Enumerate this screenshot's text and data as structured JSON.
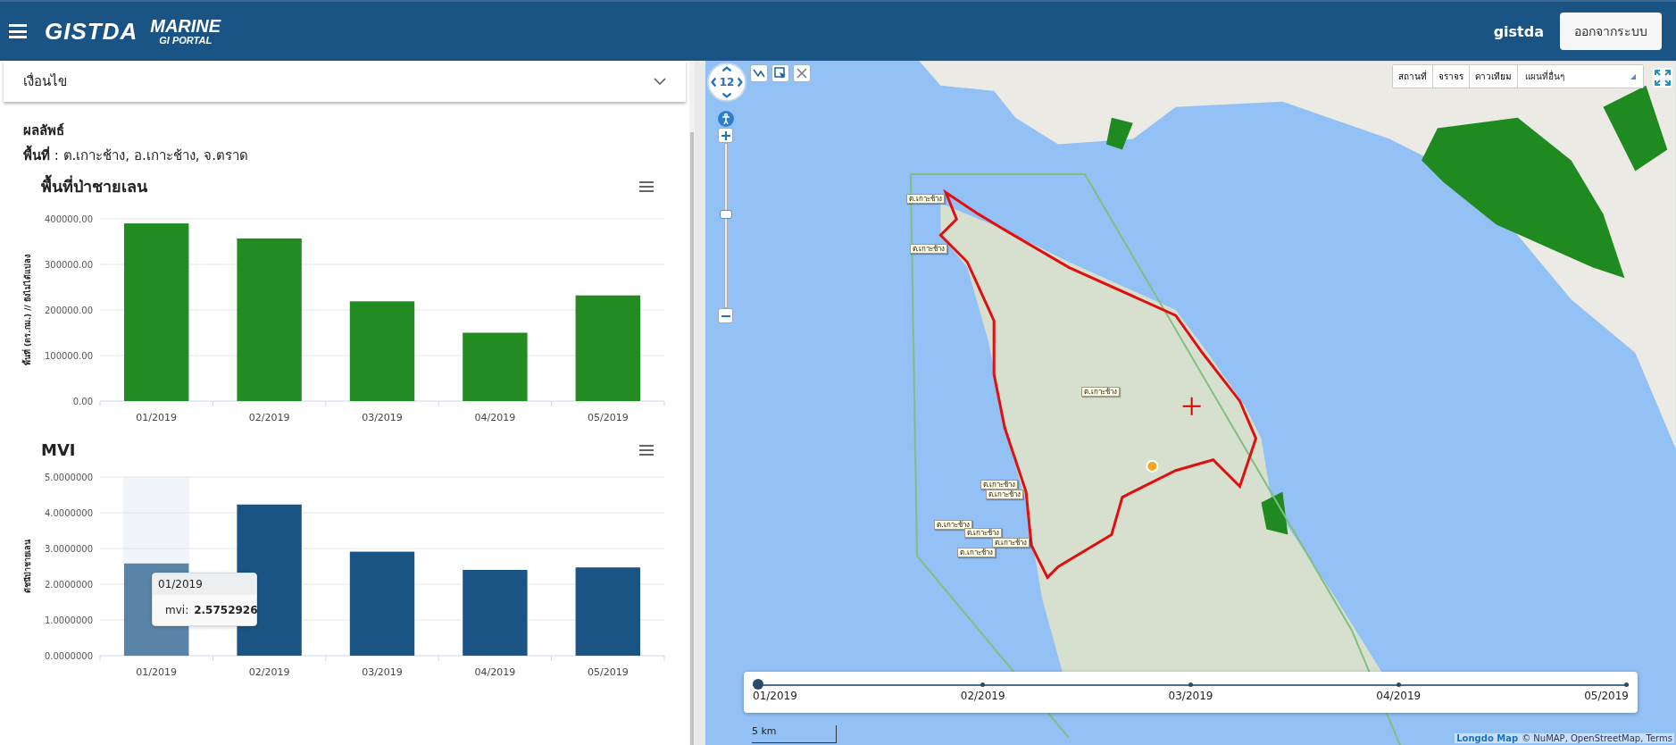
{
  "header": {
    "brand": "GISTDA",
    "logo_title": "MARINE",
    "logo_subtitle": "GI PORTAL",
    "username": "gistda",
    "logout_button": "ออกจากระบบ"
  },
  "conditions": {
    "title": "เงื่อนไข",
    "expanded": false
  },
  "results": {
    "title": "ผลลัพธ์",
    "area": "**พื้นที่** : ต.เกาะช้าง, อ.เกาะช้าง, จ.ตราด"
  },
  "charts": [
    {
      "title": "พื้นที่ป่าชายเลน",
      "chart_data": {
        "type": "bar",
        "ylabel": "พื้นที่ (ตร.กม.) // ยังไม่ได้แปลง",
        "categories": [
          "01/2019",
          "02/2019",
          "03/2019",
          "04/2019",
          "05/2019"
        ],
        "series": [
          {
            "color": "#228b22",
            "values": [
              390000,
              357000,
              219000,
              150000,
              232000
            ]
          }
        ],
        "grid": true,
        "ylim": [
          0,
          400000
        ],
        "yticks": [
          {
            "value": 0,
            "label": "0.00"
          },
          {
            "value": 100000,
            "label": "100000.00"
          },
          {
            "value": 200000,
            "label": "200000.00"
          },
          {
            "value": 300000,
            "label": "300000.00"
          },
          {
            "value": 400000,
            "label": "400000.00"
          }
        ]
      }
    },
    {
      "title": "MVI",
      "chart_data": {
        "type": "bar",
        "ylabel": "ดัชนีป่าชายเลน",
        "categories": [
          "01/2019",
          "02/2019",
          "03/2019",
          "04/2019",
          "05/2019"
        ],
        "series": [
          {
            "color": "#1a5485",
            "values": [
              2.58,
              4.23,
              2.91,
              2.4,
              2.47
            ]
          }
        ],
        "grid": true,
        "ylim": [
          0,
          5
        ],
        "yticks": [
          {
            "value": 0,
            "label": "0.0000000"
          },
          {
            "value": 1,
            "label": "1.0000000"
          },
          {
            "value": 2,
            "label": "2.0000000"
          },
          {
            "value": 3,
            "label": "3.0000000"
          },
          {
            "value": 4,
            "label": "4.0000000"
          },
          {
            "value": 5,
            "label": "5.0000000"
          }
        ]
      },
      "bars": [
        {
          "hovered": true
        },
        {
          "hovered": false
        },
        {
          "hovered": false
        },
        {
          "hovered": false
        },
        {
          "hovered": false
        }
      ],
      "tooltip": {
        "title": "01/2019",
        "series": "mvi:",
        "value": "2.5752926"
      }
    }
  ],
  "map": {
    "zoom_level": "12",
    "zoom_slider": {
      "level": 0.57
    },
    "layer_buttons": [
      {
        "label": "สถานที่"
      },
      {
        "label": "จราจร"
      },
      {
        "label": "ดาวเทียม"
      }
    ],
    "layer_dropdown": "แผนที่อื่นๆ",
    "markers": [
      {
        "label": "ต.เกาะช้าง"
      },
      {
        "label": "ต.เกาะช้าง"
      },
      {
        "label": "ต.เกาะช้าง"
      },
      {
        "label": "ต.เกาะช้าง"
      },
      {
        "label": "ต.เกาะช้าง"
      },
      {
        "label": "ต.เกาะช้าง"
      },
      {
        "label": "ต.เกาะช้าง"
      },
      {
        "label": "ต.เกาะช้าง"
      },
      {
        "label": "ต.เกาะช้าง"
      }
    ],
    "timeline": [
      {
        "label": "01/2019",
        "selected": true
      },
      {
        "label": "02/2019",
        "selected": false
      },
      {
        "label": "03/2019",
        "selected": false
      },
      {
        "label": "04/2019",
        "selected": false
      },
      {
        "label": "05/2019",
        "selected": false
      }
    ],
    "scale": "5 km",
    "logo": "Longdo Map",
    "attribution": "© NuMAP, OpenStreetMap, Terms"
  }
}
